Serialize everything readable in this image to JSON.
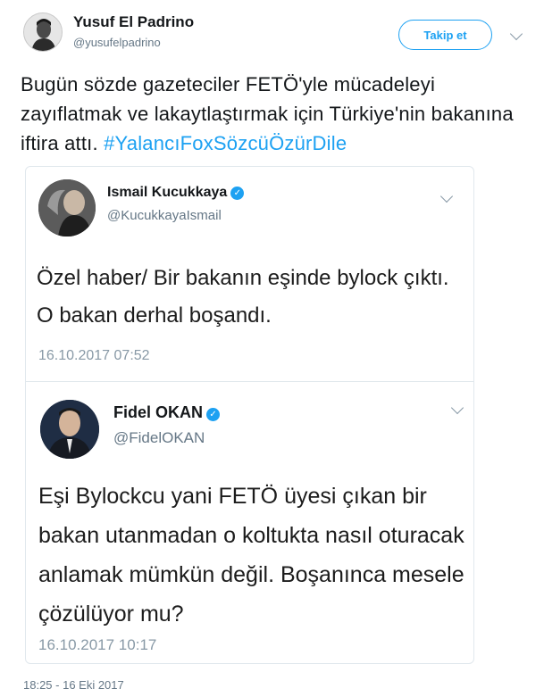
{
  "tweet": {
    "author": {
      "name": "Yusuf El Padrino",
      "handle": "@yusufelpadrino"
    },
    "follow_label": "Takip et",
    "text_plain": "Bugün sözde gazeteciler FETÖ'yle mücadeleyi zayıflatmak ve lakaytlaştırmak için Türkiye'nin bakanına iftira attı. ",
    "hashtag": "#YalancıFoxSözcüÖzürDile",
    "timestamp": "18:25 - 16 Eki 2017"
  },
  "quoted": {
    "author": {
      "name": "Ismail Kucukkaya",
      "handle": "@KucukkayaIsmail",
      "verified": true
    },
    "text": "Özel haber/ Bir bakanın eşinde bylock çıktı. O bakan derhal boşandı.",
    "timestamp": "16.10.2017 07:52"
  },
  "nested_quote": {
    "author": {
      "name": "Fidel OKAN",
      "handle": "@FidelOKAN",
      "verified": true
    },
    "text": "Eşi Bylockcu yani FETÖ üyesi çıkan bir bakan utanmadan o koltukta nasıl oturacak anlamak mümkün değil. Boşanınca mesele çözülüyor mu?",
    "timestamp": "16.10.2017 10:17"
  },
  "icons": {
    "verified": "verified-badge-icon",
    "menu": "chevron-down-icon"
  },
  "colors": {
    "link_blue": "#1da1f2",
    "muted_gray": "#657786",
    "border": "#e1e8ed"
  }
}
